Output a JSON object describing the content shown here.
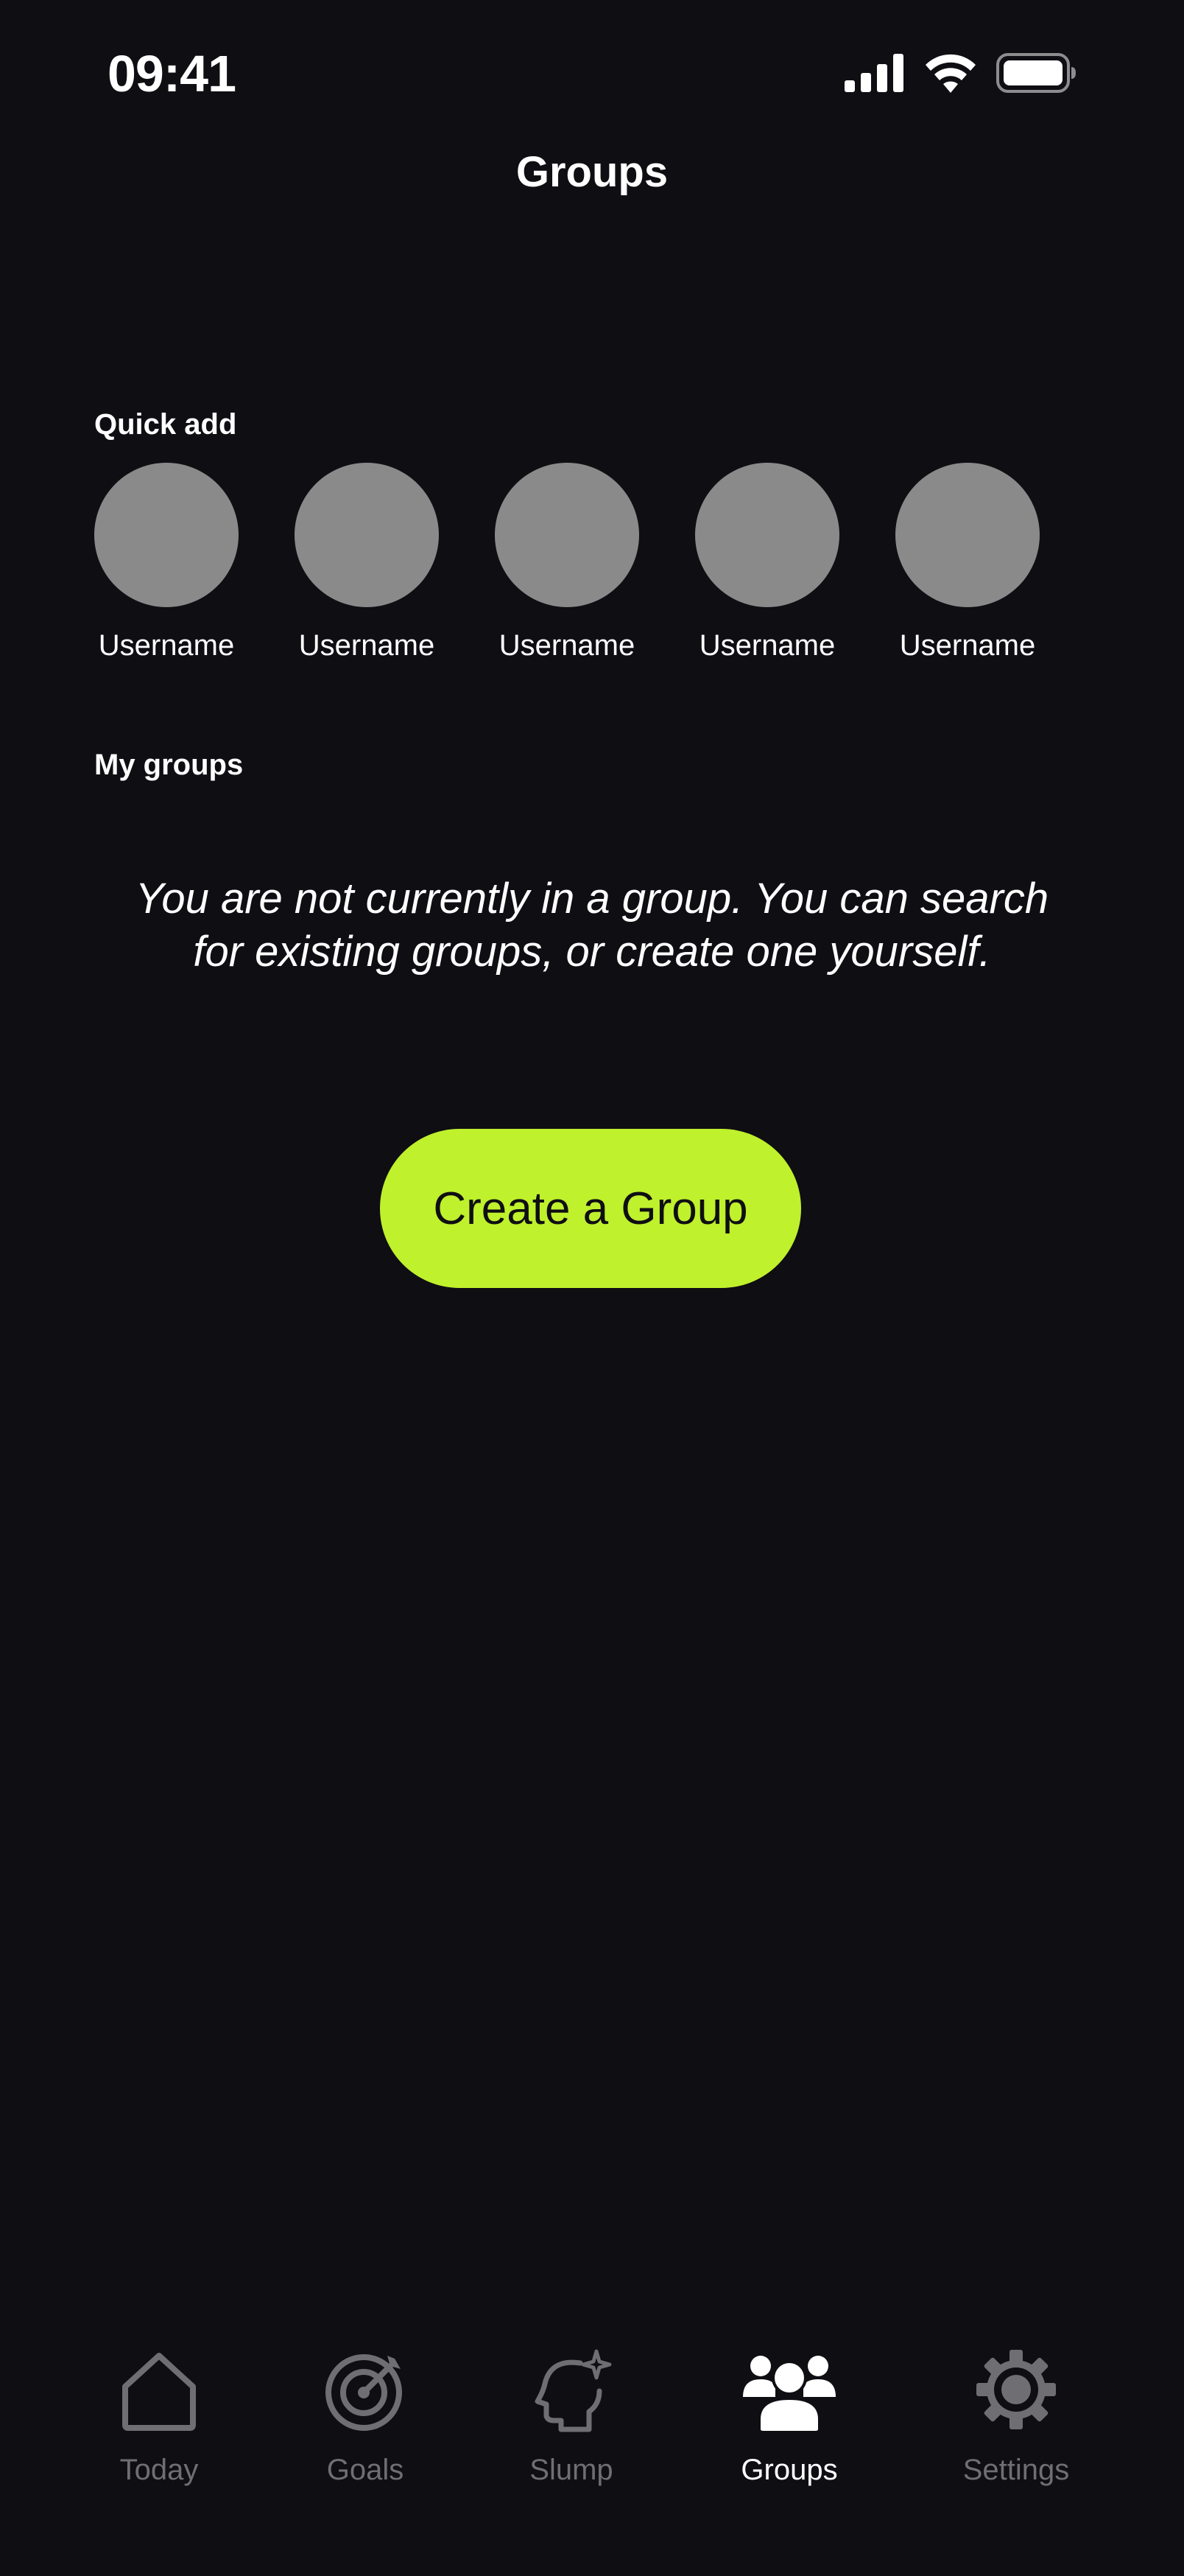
{
  "status_bar": {
    "time": "09:41"
  },
  "header": {
    "title": "Groups"
  },
  "quick_add": {
    "label": "Quick add",
    "users": [
      {
        "name": "Username"
      },
      {
        "name": "Username"
      },
      {
        "name": "Username"
      },
      {
        "name": "Username"
      },
      {
        "name": "Username"
      }
    ]
  },
  "my_groups": {
    "label": "My groups",
    "empty_message": "You are not currently in a group. You can search for existing groups, or create one yourself.",
    "create_button_label": "Create a Group"
  },
  "tab_bar": {
    "tabs": [
      {
        "label": "Today",
        "icon": "home-icon",
        "active": false
      },
      {
        "label": "Goals",
        "icon": "target-icon",
        "active": false
      },
      {
        "label": "Slump",
        "icon": "head-sparkle-icon",
        "active": false
      },
      {
        "label": "Groups",
        "icon": "people-icon",
        "active": true
      },
      {
        "label": "Settings",
        "icon": "gear-icon",
        "active": false
      }
    ]
  },
  "colors": {
    "background": "#0f0e13",
    "accent": "#bff12c",
    "avatar_placeholder": "#8a8a8a",
    "inactive_tab": "#6f6f73",
    "active_tab": "#ffffff"
  }
}
